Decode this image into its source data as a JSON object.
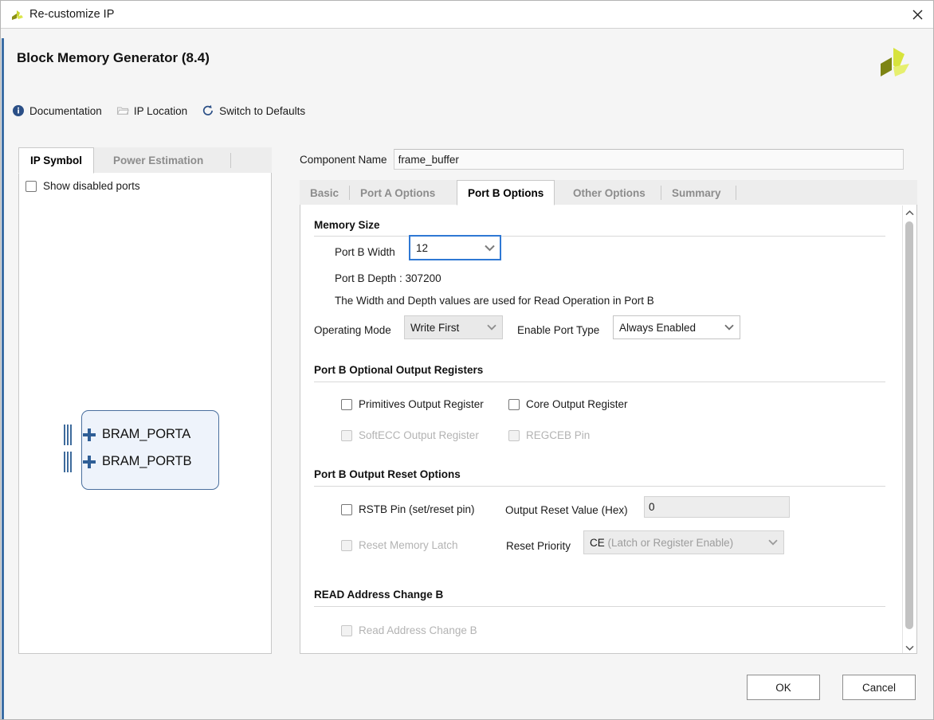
{
  "window": {
    "title": "Re-customize IP",
    "title_icon": "xilinx-logo-icon",
    "close_icon": "close-icon"
  },
  "header": {
    "ip_title": "Block Memory Generator (8.4)",
    "brand_logo": "xilinx-pinwheel-logo"
  },
  "toolbar": {
    "documentation": "Documentation",
    "documentation_icon": "info-icon",
    "ip_location": "IP Location",
    "ip_location_icon": "folder-icon",
    "switch_defaults": "Switch to Defaults",
    "switch_defaults_icon": "refresh-icon"
  },
  "left_panel": {
    "tabs": [
      {
        "label": "IP Symbol",
        "active": true
      },
      {
        "label": "Power Estimation",
        "active": false
      }
    ],
    "show_disabled_ports": {
      "label": "Show disabled ports",
      "checked": false
    },
    "symbol": {
      "port_a": "BRAM_PORTA",
      "port_b": "BRAM_PORTB",
      "expand_icon": "plus-icon"
    }
  },
  "component": {
    "label": "Component Name",
    "value": "frame_buffer",
    "placeholder": ""
  },
  "tabs": [
    {
      "label": "Basic",
      "active": false
    },
    {
      "label": "Port A Options",
      "active": false
    },
    {
      "label": "Port B Options",
      "active": true
    },
    {
      "label": "Other Options",
      "active": false
    },
    {
      "label": "Summary",
      "active": false
    }
  ],
  "port_b": {
    "memory_size": {
      "heading": "Memory Size",
      "width_label": "Port B Width",
      "width_value": "12",
      "depth_text": "Port B Depth : 307200",
      "note": "The Width and Depth values are used for Read Operation in Port B"
    },
    "modes": {
      "operating_mode_label": "Operating Mode",
      "operating_mode_value": "Write First",
      "enable_port_type_label": "Enable Port Type",
      "enable_port_type_value": "Always Enabled"
    },
    "output_registers": {
      "heading": "Port B Optional Output Registers",
      "items": [
        {
          "label": "Primitives Output Register",
          "checked": false,
          "enabled": true
        },
        {
          "label": "Core Output Register",
          "checked": false,
          "enabled": true
        },
        {
          "label": "SoftECC Output Register",
          "checked": false,
          "enabled": false
        },
        {
          "label": "REGCEB Pin",
          "checked": false,
          "enabled": false
        }
      ]
    },
    "reset_options": {
      "heading": "Port B Output Reset Options",
      "rstb_label": "RSTB Pin (set/reset pin)",
      "rstb_checked": false,
      "reset_memory_latch_label": "Reset Memory Latch",
      "reset_memory_latch_checked": false,
      "output_reset_value_label": "Output Reset Value (Hex)",
      "output_reset_value": "0",
      "reset_priority_label": "Reset Priority",
      "reset_priority_value": "CE",
      "reset_priority_suffix": " (Latch or Register Enable)"
    },
    "read_address_change": {
      "heading": "READ Address Change B",
      "checkbox_label": "Read Address Change B",
      "checked": false
    }
  },
  "scrollbar": {
    "up_icon": "chevron-up-icon",
    "down_icon": "chevron-down-icon"
  },
  "footer": {
    "ok": "OK",
    "cancel": "Cancel"
  },
  "colors": {
    "accent_blue": "#3b6ea5",
    "focus_blue": "#2f78d4",
    "symbol_fill": "#eef3fb",
    "symbol_border": "#4a6f9e",
    "brand_olive": "#8a8f16",
    "brand_yellow": "#d6e03a",
    "disabled_text": "#b3b3b3"
  }
}
